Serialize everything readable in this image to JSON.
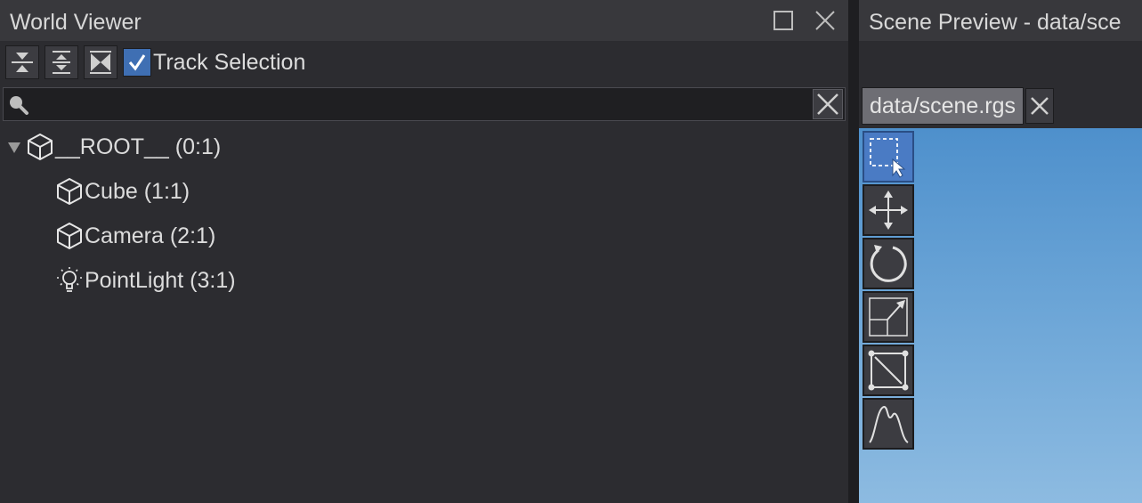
{
  "world_viewer": {
    "title": "World Viewer",
    "toolbar": {
      "track_selection_label": "Track Selection",
      "track_selection_checked": true
    },
    "search": {
      "placeholder": "",
      "value": ""
    },
    "tree": [
      {
        "label": "__ROOT__ (0:1)",
        "icon": "cube-icon",
        "depth": 0,
        "expanded": true
      },
      {
        "label": "Cube (1:1)",
        "icon": "cube-icon",
        "depth": 1
      },
      {
        "label": "Camera (2:1)",
        "icon": "cube-icon",
        "depth": 1
      },
      {
        "label": "PointLight (3:1)",
        "icon": "lightbulb-icon",
        "depth": 1
      }
    ]
  },
  "scene_preview": {
    "title": "Scene Preview - data/sce",
    "tab_label": "data/scene.rgs",
    "tools": [
      {
        "name": "select-tool",
        "icon": "marquee-select-icon",
        "active": true
      },
      {
        "name": "move-tool",
        "icon": "move-arrows-icon",
        "active": false
      },
      {
        "name": "rotate-tool",
        "icon": "rotate-icon",
        "active": false
      },
      {
        "name": "scale-tool",
        "icon": "scale-icon",
        "active": false
      },
      {
        "name": "rect-tool",
        "icon": "rect-transform-icon",
        "active": false
      },
      {
        "name": "terrain-tool",
        "icon": "terrain-peak-icon",
        "active": false
      }
    ]
  },
  "colors": {
    "panel_bg": "#2c2c30",
    "titlebar_bg": "#38383c",
    "accent": "#3f6fb3",
    "viewport_top": "#4e90cc",
    "viewport_bottom": "#8dbbe1"
  }
}
